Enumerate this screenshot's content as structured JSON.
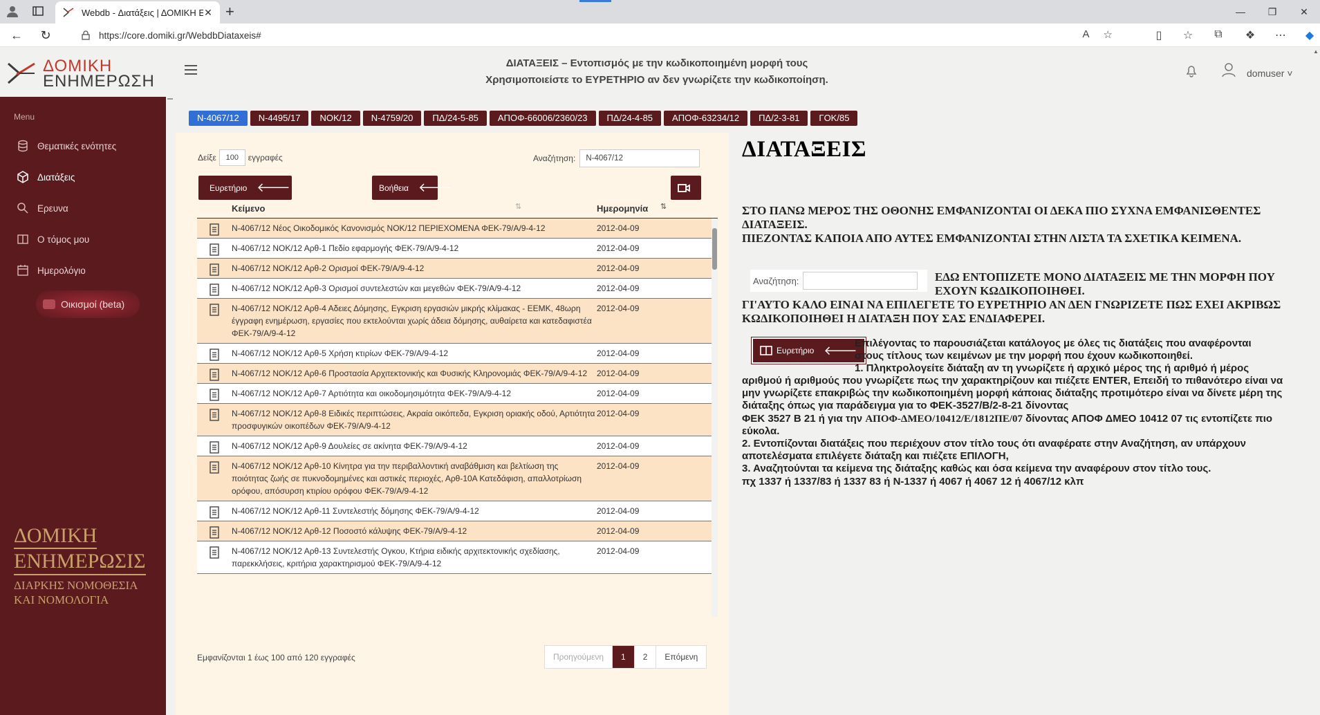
{
  "browser": {
    "tab_title": "Webdb - Διατάξεις | ΔΟΜΙΚΗ ΕΝ",
    "url": "https://core.domiki.gr/WebdbDiataxeis#"
  },
  "header": {
    "logo_line1": "ΔΟΜΙΚΗ",
    "logo_line2": "ΕΝΗΜΕΡΩΣΗ",
    "title_line1": "ΔΙΑΤΑΞΕΙΣ – Εντοπισμός με την κωδικοποιημένη μορφή τους",
    "title_line2": "Χρησιμοποιείστε το ΕΥΡΕΤΗΡΙΟ αν δεν γνωρίζετε την κωδικοποίηση.",
    "username": "domuser"
  },
  "sidebar": {
    "menu_label": "Menu",
    "items": [
      {
        "label": "Θεματικές ενότητες",
        "icon": "database-icon"
      },
      {
        "label": "Διατάξεις",
        "icon": "cube-icon"
      },
      {
        "label": "Ερευνα",
        "icon": "search-icon"
      },
      {
        "label": "Ο τόμος μου",
        "icon": "book-icon"
      },
      {
        "label": "Ημερολόγιο",
        "icon": "calendar-icon"
      }
    ],
    "beta_item": "Οικισμοί (beta)",
    "brand_line1": "ΔΟΜΙΚΗ",
    "brand_line2": "ΕΝΗΜΕΡΩΣΙΣ",
    "brand_line3": "ΔΙΑΡΚΗΣ ΝΟΜΟΘΕΣΙΑ",
    "brand_line4": "ΚΑΙ ΝΟΜΟΛΟΓΙΑ"
  },
  "tags": [
    "Ν-4067/12",
    "Ν-4495/17",
    "ΝΟΚ/12",
    "Ν-4759/20",
    "ΠΔ/24-5-85",
    "ΑΠΟΦ-66006/2360/23",
    "ΠΔ/24-4-85",
    "ΑΠΟΦ-63234/12",
    "ΠΔ/2-3-81",
    "ΓΟΚ/85"
  ],
  "list": {
    "show_label": "Δείξε",
    "show_value": "100",
    "show_suffix": "εγγραφές",
    "search_label": "Αναζήτηση:",
    "search_value": "Ν-4067/12",
    "btn_index": "Ευρετήριο",
    "btn_help": "Βοήθεια",
    "col_text": "Κείμενο",
    "col_date": "Ημερομηνία",
    "rows": [
      {
        "text": "Ν-4067/12 Νέος Οικοδομικός Κανονισμός ΝΟΚ/12 ΠΕΡΙΕΧΟΜΕΝΑ ΦΕΚ-79/Α/9-4-12",
        "date": "2012-04-09"
      },
      {
        "text": "Ν-4067/12 ΝΟΚ/12 Αρθ-1 Πεδίο εφαρμογής ΦΕΚ-79/Α/9-4-12",
        "date": "2012-04-09"
      },
      {
        "text": "Ν-4067/12 ΝΟΚ/12 Αρθ-2 Ορισμοί ΦΕΚ-79/Α/9-4-12",
        "date": "2012-04-09"
      },
      {
        "text": "Ν-4067/12 ΝΟΚ/12 Αρθ-3 Ορισμοί συντελεστών και μεγεθών ΦΕΚ-79/Α/9-4-12",
        "date": "2012-04-09"
      },
      {
        "text": "Ν-4067/12 ΝΟΚ/12 Αρθ-4 Αδειες Δόμησης, Εγκριση εργασιών μικρής κλίμακας - ΕΕΜΚ, 48ωρη έγγραφη ενημέρωση, εργασίες που εκτελούνται χωρίς άδεια δόμησης, αυθαίρετα και κατεδαφιστέα ΦΕΚ-79/Α/9-4-12",
        "date": "2012-04-09"
      },
      {
        "text": "Ν-4067/12 ΝΟΚ/12 Αρθ-5 Χρήση κτιρίων ΦΕΚ-79/Α/9-4-12",
        "date": "2012-04-09"
      },
      {
        "text": "Ν-4067/12 ΝΟΚ/12 Αρθ-6 Προστασία Αρχιτεκτονικής και Φυσικής Κληρονομιάς ΦΕΚ-79/Α/9-4-12",
        "date": "2012-04-09"
      },
      {
        "text": "Ν-4067/12 ΝΟΚ/12 Αρθ-7 Αρτιότητα και οικοδομησιμότητα ΦΕΚ-79/Α/9-4-12",
        "date": "2012-04-09"
      },
      {
        "text": "Ν-4067/12 ΝΟΚ/12 Αρθ-8 Ειδικές περιπτώσεις, Ακραία οικόπεδα, Εγκριση οριακής οδού, Αρτιότητα προσφυγικών οικοπέδων ΦΕΚ-79/Α/9-4-12",
        "date": "2012-04-09"
      },
      {
        "text": "Ν-4067/12 ΝΟΚ/12 Αρθ-9 Δουλείες σε ακίνητα ΦΕΚ-79/Α/9-4-12",
        "date": "2012-04-09"
      },
      {
        "text": "Ν-4067/12 ΝΟΚ/12 Αρθ-10 Κίνητρα για την περιβαλλοντική αναβάθμιση και βελτίωση της ποιότητας ζωής σε πυκνοδομημένες και αστικές περιοχές, Αρθ-10Α Κατεδάφιση, απαλλοτρίωση ορόφου, απόσυρση κτιρίου ορόφου ΦΕΚ-79/Α/9-4-12",
        "date": "2012-04-09"
      },
      {
        "text": "Ν-4067/12 ΝΟΚ/12 Αρθ-11 Συντελεστής δόμησης ΦΕΚ-79/Α/9-4-12",
        "date": "2012-04-09"
      },
      {
        "text": "Ν-4067/12 ΝΟΚ/12 Αρθ-12 Ποσοστό κάλυψης ΦΕΚ-79/Α/9-4-12",
        "date": "2012-04-09"
      },
      {
        "text": "Ν-4067/12 ΝΟΚ/12 Αρθ-13 Συντελεστής Ογκου, Κτήρια ειδικής αρχιτεκτονικής σχεδίασης, παρεκκλήσεις, κριτήρια χαρακτηρισμού ΦΕΚ-79/Α/9-4-12",
        "date": "2012-04-09"
      }
    ],
    "footer": "Εμφανίζονται 1 έως 100 από 120 εγγραφές",
    "pager": {
      "prev": "Προηγούμενη",
      "p1": "1",
      "p2": "2",
      "next": "Επόμενη"
    }
  },
  "help": {
    "title": "ΔΙΑΤΑΞΕΙΣ",
    "p1": "ΣΤΟ ΠΑΝΩ ΜΕΡΟΣ ΤΗΣ ΟΘΟΝΗΣ ΕΜΦΑΝΙΖΟΝΤΑΙ ΟΙ ΔΕΚΑ ΠΙΟ ΣΥΧΝΑ ΕΜΦΑΝΙΣΘΕΝΤΕΣ ΔΙΑΤΑΞΕΙΣ.",
    "p2": "ΠΙΕΖΟΝΤΑΣ ΚΑΠΟΙΑ ΑΠΟ ΑΥΤΕΣ ΕΜΦΑΝΙΖΟΝΤΑΙ ΣΤΗΝ ΛΙΣΤΑ ΤΑ ΣΧΕΤΙΚΑ ΚΕΙΜΕΝΑ.",
    "search_label": "Αναζήτηση:",
    "p3": "ΕΔΩ ΕΝΤΟΠΙΖΕΤΕ ΜΟΝΟ ΔΙΑΤΑΞΕΙΣ ΜΕ ΤΗΝ ΜΟΡΦΗ ΠΟΥ ΕΧΟΥΝ ΚΩΔΙΚΟΠΟΙΗΘΕΙ.",
    "p4": "ΓΙ'ΑΥΤΟ ΚΑΛΟ ΕΙΝΑΙ ΝΑ ΕΠΙΛΕΓΕΤΕ ΤΟ ΕΥΡΕΤΗΡΙΟ ΑΝ ΔΕΝ ΓΝΩΡΙΖΕΤΕ ΠΩΣ ΕΧΕΙ ΑΚΡΙΒΩΣ ΚΩΔΙΚΟΠΟΙΗΘΕΙ Η ΔΙΑΤΑΞΗ ΠΟΥ ΣΑΣ ΕΝΔΙΑΦΕΡΕΙ.",
    "btn_index": "Ευρετήριο",
    "p5": "Επιλέγοντας το παρουσιάζεται κατάλογος με όλες τις διατάξεις που αναφέρονται στους τίτλους των κειμένων με την μορφή που έχουν κωδικοποιηθεί.",
    "p6": "1. Πληκτρολογείτε διάταξη αν τη γνωρίζετε ή αρχικό μέρος της ή αριθμό ή μέρος αριθμού ή αριθμούς που γνωρίζετε πως την χαρακτηρίζουν και πιέζετε ENTER, Επειδή το πιθανότερο είναι να μην γνωρίζετε επακριβώς την κωδικοποιημένη μορφή κάποιας διάταξης προτιμότερο είναι να δίνετε μέρη της διάταξης όπως για παράδειγμα για το ΦΕΚ-3527/Β/2-8-21 δίνοντας",
    "p7a": "ΦΕΚ 3527 Β 21 ή για την",
    "p7b": "ΑΠΟΦ-ΔΜΕΟ/10412/Ε/1812ΠΕ/07",
    "p7c": "δίνοντας ΑΠΟΦ ΔΜΕΟ 10412 07 τις εντοπίζετε πιο εύκολα.",
    "p8": "2. Εντοπίζονται διατάξεις που περιέχουν στον τίτλο τους ότι αναφέρατε στην Αναζήτηση, αν υπάρχουν αποτελέσματα επιλέγετε διάταξη και πιέζετε ΕΠΙΛΟΓΗ,",
    "p9": "3. Αναζητούνται τα κείμενα της διάταξης καθώς και όσα κείμενα την αναφέρουν στον τίτλο τους.",
    "p10": "πχ 1337 ή 1337/83 ή 1337 83 ή Ν-1337 ή 4067 ή 4067 12 ή 4067/12 κλπ"
  },
  "colors": {
    "brand_maroon": "#5b1a1e",
    "tag_selected": "#2f6fd6",
    "row_stripe": "#fde3c6",
    "panel_bg": "#fef5e7"
  }
}
